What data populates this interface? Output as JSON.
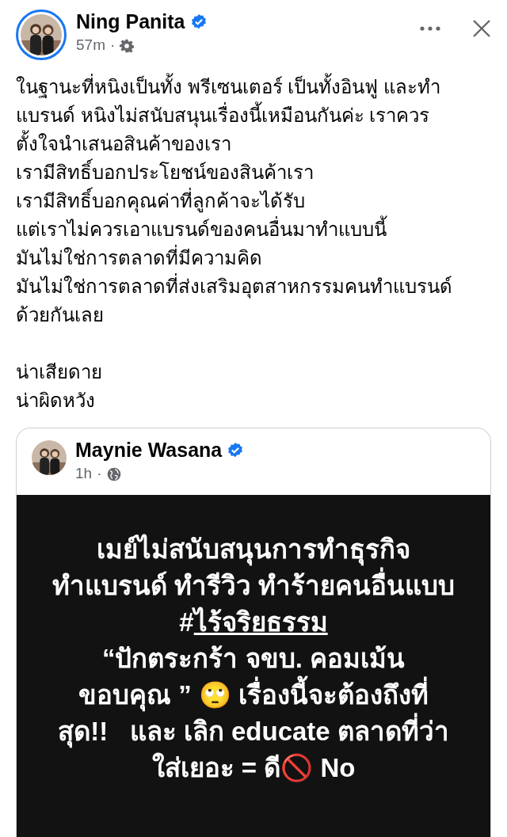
{
  "post": {
    "author": "Ning Panita",
    "verified": true,
    "has_story": true,
    "time": "57m",
    "separator": "·",
    "lines": [
      "ในฐานะที่หนิงเป็นทั้ง พรีเซนเตอร์ เป็นทั้งอินฟู และทำ",
      "แบรนด์ หนิงไม่สนับสนุนเรื่องนี้เหมือนกันค่ะ เราควร",
      "ตั้งใจนำเสนอสินค้าของเรา",
      "เรามีสิทธิ์บอกประโยชน์ของสินค้าเรา",
      "เรามีสิทธิ์บอกคุณค่าที่ลูกค้าจะได้รับ",
      "แต่เราไม่ควรเอาแบรนด์ของคนอื่นมาทำแบบนี้",
      "มันไม่ใช่การตลาดที่มีความคิด",
      "มันไม่ใช่การตลาดที่ส่งเสริมอุตสาหกรรมคนทำแบรนด์",
      "ด้วยกันเลย"
    ],
    "closing_lines": [
      "น่าเสียดาย",
      "น่าผิดหวัง"
    ],
    "shared": {
      "author": "Maynie Wasana",
      "verified": true,
      "time": "1h",
      "separator": "·",
      "image_lines": [
        {
          "kind": "plain",
          "text": "เมย์ไม่สนับสนุนการทำธุรกิจ"
        },
        {
          "kind": "plain",
          "text": "ทำแบรนด์ ทำรีวิว ทำร้ายคนอื่นแบบ"
        },
        {
          "kind": "hashtag",
          "hash": "#",
          "tag": "ไร้จริยธรรม"
        },
        {
          "kind": "plain",
          "text": "“ปักตระกร้า จขบ. คอมเม้น"
        },
        {
          "kind": "plain",
          "text": "ขอบคุณ ” 🙄 เรื่องนี้จะต้องถึงที่"
        },
        {
          "kind": "plain",
          "text": "สุด!!   และ เลิก educate ตลาดที่ว่า"
        },
        {
          "kind": "plain",
          "text": "ใส่เยอะ = ดี🚫 No"
        }
      ]
    }
  }
}
